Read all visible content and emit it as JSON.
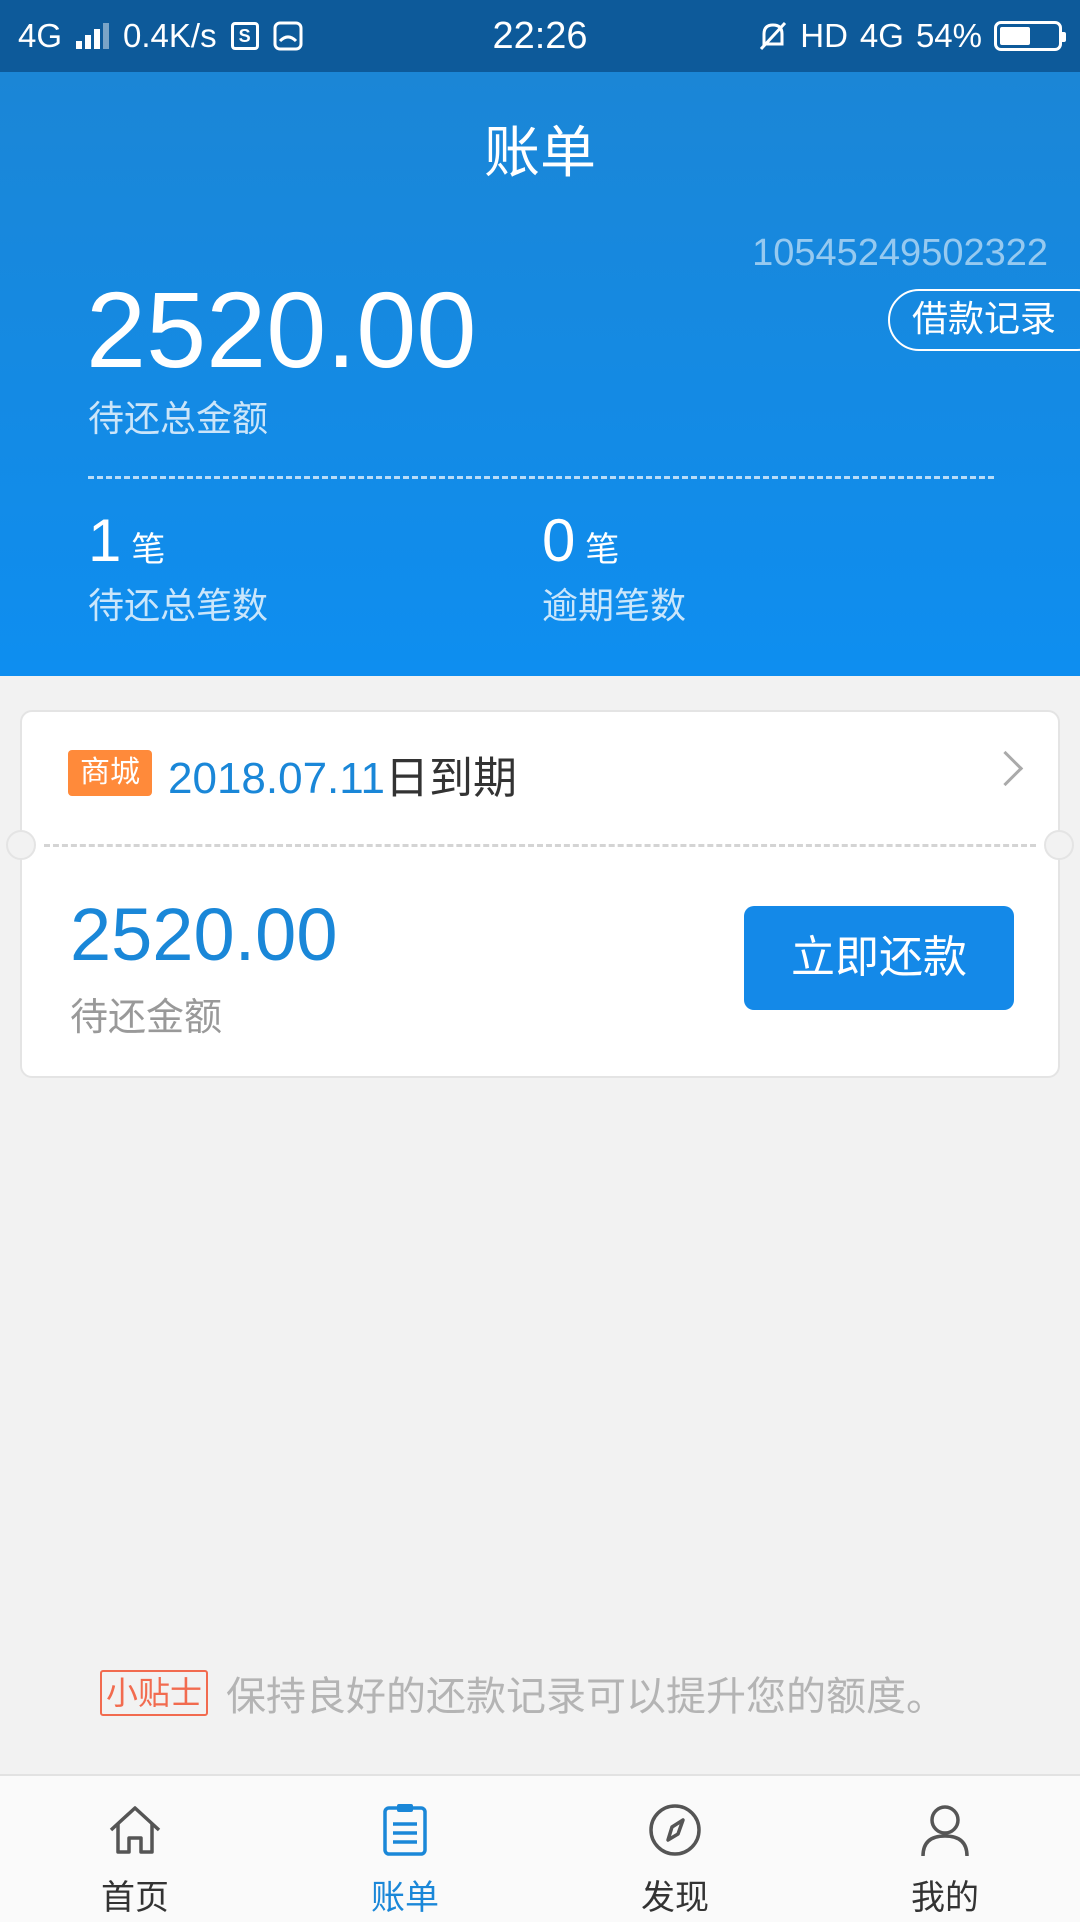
{
  "status_bar": {
    "network": "4G",
    "speed": "0.4K/s",
    "time": "22:26",
    "hd": "HD",
    "net_right": "4G",
    "battery": "54%",
    "battery_level": 0.54
  },
  "header": {
    "title": "账单",
    "account_id": "10545249502322",
    "loan_record_button": "借款记录",
    "total_amount": "2520.00",
    "total_amount_label": "待还总金额",
    "pending_count": "1",
    "pending_unit": "笔",
    "pending_label": "待还总笔数",
    "overdue_count": "0",
    "overdue_unit": "笔",
    "overdue_label": "逾期笔数"
  },
  "bill": {
    "tag": "商城",
    "due_date": "2018.07.11",
    "due_suffix": "日到期",
    "amount": "2520.00",
    "amount_label": "待还金额",
    "repay_button": "立即还款"
  },
  "tip": {
    "badge": "小贴士",
    "text": "保持良好的还款记录可以提升您的额度。"
  },
  "nav": {
    "items": [
      {
        "label": "首页",
        "icon": "home-icon"
      },
      {
        "label": "账单",
        "icon": "bill-icon",
        "active": true
      },
      {
        "label": "发现",
        "icon": "compass-icon"
      },
      {
        "label": "我的",
        "icon": "user-icon"
      }
    ],
    "active_color": "#1a87d8"
  }
}
